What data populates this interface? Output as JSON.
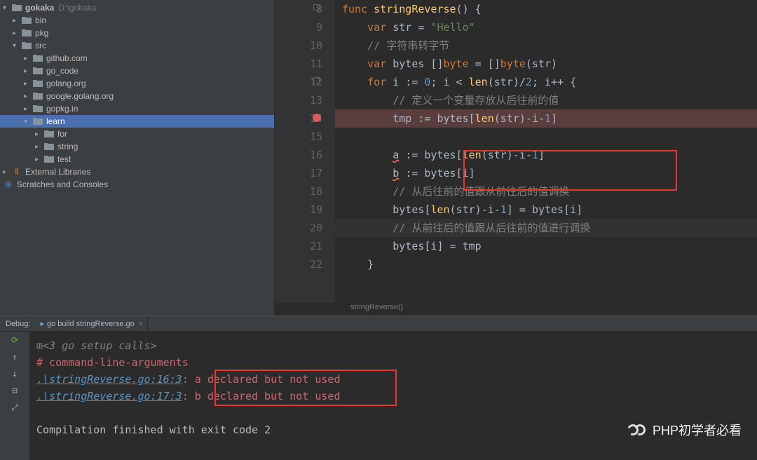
{
  "project": {
    "name": "gokaka",
    "path": "D:\\gokaka",
    "tree": [
      {
        "label": "bin",
        "icon": "folder",
        "indent": 1,
        "expanded": false
      },
      {
        "label": "pkg",
        "icon": "folder",
        "indent": 1,
        "expanded": false
      },
      {
        "label": "src",
        "icon": "folder",
        "indent": 1,
        "expanded": true
      },
      {
        "label": "github.com",
        "icon": "folder",
        "indent": 2,
        "expanded": false
      },
      {
        "label": "go_code",
        "icon": "folder",
        "indent": 2,
        "expanded": false
      },
      {
        "label": "golang.org",
        "icon": "folder",
        "indent": 2,
        "expanded": false
      },
      {
        "label": "google.golang.org",
        "icon": "folder",
        "indent": 2,
        "expanded": false
      },
      {
        "label": "gopkg.in",
        "icon": "folder",
        "indent": 2,
        "expanded": false
      },
      {
        "label": "learn",
        "icon": "folder",
        "indent": 2,
        "expanded": true,
        "active": true
      },
      {
        "label": "for",
        "icon": "folder",
        "indent": 3,
        "expanded": false
      },
      {
        "label": "string",
        "icon": "folder",
        "indent": 3,
        "expanded": false
      },
      {
        "label": "test",
        "icon": "folder",
        "indent": 3,
        "expanded": false
      }
    ],
    "ext_libs": "External Libraries",
    "scratches": "Scratches and Consoles"
  },
  "editor": {
    "breadcrumb": "stringReverse()",
    "first_line": 8,
    "breakpoint_line": 14,
    "cursor_line": 20,
    "lines": [
      {
        "n": 8,
        "tokens": [
          [
            "kw",
            "func "
          ],
          [
            "fn",
            "stringReverse"
          ],
          [
            "punc",
            "() {"
          ]
        ]
      },
      {
        "n": 9,
        "tokens": [
          [
            "",
            "    "
          ],
          [
            "kw",
            "var "
          ],
          [
            "",
            "str = "
          ],
          [
            "str",
            "\"Hello\""
          ]
        ]
      },
      {
        "n": 10,
        "tokens": [
          [
            "",
            "    "
          ],
          [
            "cm",
            "// 字符串转字节"
          ]
        ]
      },
      {
        "n": 11,
        "tokens": [
          [
            "",
            "    "
          ],
          [
            "kw",
            "var "
          ],
          [
            "",
            "bytes []"
          ],
          [
            "kw",
            "byte"
          ],
          [
            "",
            ""
          ],
          [
            "",
            ""
          ],
          [
            "",
            ""
          ],
          [
            "",
            ""
          ],
          [
            "",
            ""
          ],
          [
            "",
            " = []"
          ],
          [
            "kw",
            "byte"
          ],
          [
            "",
            "(str)"
          ]
        ]
      },
      {
        "n": 12,
        "tokens": [
          [
            "",
            "    "
          ],
          [
            "kw",
            "for "
          ],
          [
            "",
            "i := "
          ],
          [
            "num",
            "0"
          ],
          [
            "",
            "; i < "
          ],
          [
            "fn",
            "len"
          ],
          [
            "",
            "(str)/"
          ],
          [
            "num",
            "2"
          ],
          [
            "",
            "; i++ {"
          ]
        ]
      },
      {
        "n": 13,
        "tokens": [
          [
            "",
            "        "
          ],
          [
            "cm",
            "// 定义一个变量存放从后往前的值"
          ]
        ]
      },
      {
        "n": 14,
        "tokens": [
          [
            "",
            "        tmp "
          ],
          [
            "op",
            ":="
          ],
          [
            "",
            " bytes["
          ],
          [
            "fn",
            "len"
          ],
          [
            "",
            "(str)"
          ],
          [
            "op",
            "-"
          ],
          [
            "",
            "i"
          ],
          [
            "op",
            "-"
          ],
          [
            "num",
            "1"
          ],
          [
            "",
            "]"
          ]
        ]
      },
      {
        "n": 15,
        "tokens": [
          [
            "",
            ""
          ]
        ]
      },
      {
        "n": 16,
        "tokens": [
          [
            "",
            "        "
          ],
          [
            "err",
            "a"
          ],
          [
            "",
            " "
          ],
          [
            "op",
            ":="
          ],
          [
            "",
            " bytes["
          ],
          [
            "fn",
            "len"
          ],
          [
            "",
            "(str)"
          ],
          [
            "op",
            "-"
          ],
          [
            "",
            "i"
          ],
          [
            "op",
            "-"
          ],
          [
            "num",
            "1"
          ],
          [
            "",
            "]"
          ]
        ]
      },
      {
        "n": 17,
        "tokens": [
          [
            "",
            "        "
          ],
          [
            "err",
            "b"
          ],
          [
            "",
            " "
          ],
          [
            "op",
            ":="
          ],
          [
            "",
            " bytes[i]"
          ]
        ]
      },
      {
        "n": 18,
        "tokens": [
          [
            "",
            "        "
          ],
          [
            "cm",
            "// 从后往前的值跟从前往后的值调换"
          ]
        ]
      },
      {
        "n": 19,
        "tokens": [
          [
            "",
            "        bytes["
          ],
          [
            "fn",
            "len"
          ],
          [
            "",
            "(str)"
          ],
          [
            "op",
            "-"
          ],
          [
            "",
            "i"
          ],
          [
            "op",
            "-"
          ],
          [
            "num",
            "1"
          ],
          [
            "",
            "] = bytes[i]"
          ]
        ]
      },
      {
        "n": 20,
        "tokens": [
          [
            "",
            "        "
          ],
          [
            "cm",
            "// 从前往后的值跟从后往前的值进行调换"
          ]
        ]
      },
      {
        "n": 21,
        "tokens": [
          [
            "",
            "        bytes[i] = tmp"
          ]
        ]
      },
      {
        "n": 22,
        "tokens": [
          [
            "",
            "    }"
          ]
        ]
      }
    ]
  },
  "debug": {
    "label": "Debug:",
    "tab": "go build stringReverse.go",
    "console": [
      {
        "cls": "con-gray",
        "prefix": "⊞",
        "text": "<3 go setup calls>"
      },
      {
        "cls": "con-red",
        "text": "# command-line-arguments"
      },
      {
        "cls": "mix",
        "link": ".\\stringReverse.go:16:3",
        "sep": ": ",
        "msg": "a declared but not used"
      },
      {
        "cls": "mix",
        "link": ".\\stringReverse.go:17:3",
        "sep": ": ",
        "msg": "b declared but not used"
      },
      {
        "cls": "",
        "text": ""
      },
      {
        "cls": "con-plain",
        "text": "Compilation finished with exit code 2"
      }
    ]
  },
  "watermark": "PHP初学者必看"
}
